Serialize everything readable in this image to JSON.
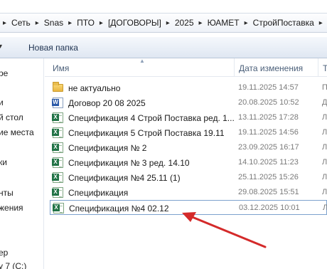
{
  "address_bar": {
    "crumbs": [
      "Сеть",
      "Snas",
      "ПТО",
      "[ДОГОВОРЫ]",
      "2025",
      "ЮАМЕТ",
      "СтройПоставка"
    ]
  },
  "toolbar": {
    "new_folder_label": "Новая папка"
  },
  "nav_pane": {
    "items": [
      "ре",
      "и",
      "й стол",
      "ие места",
      "ки",
      "нты",
      "жения",
      "ер",
      "у 7 (C:)"
    ]
  },
  "columns": {
    "name": "Имя",
    "date": "Дата изменения",
    "type_partial": "Т"
  },
  "files": [
    {
      "name": "не актуально",
      "date": "19.11.2025 14:57",
      "type": "П",
      "icon": "folder-icon"
    },
    {
      "name": "Договор 20 08 2025",
      "date": "20.08.2025 10:52",
      "type": "Д",
      "icon": "word-document-icon"
    },
    {
      "name": "Спецификация 4 Строй Поставка ред. 1...",
      "date": "13.11.2025 17:28",
      "type": "Л",
      "icon": "excel-spreadsheet-icon"
    },
    {
      "name": "Спецификация 5 Строй Поставка 19.11",
      "date": "19.11.2025 14:56",
      "type": "Л",
      "icon": "excel-spreadsheet-icon"
    },
    {
      "name": "Спецификация № 2",
      "date": "23.09.2025 16:17",
      "type": "Л",
      "icon": "excel-spreadsheet-icon"
    },
    {
      "name": "Спецификация № 3 ред. 14.10",
      "date": "14.10.2025 11:23",
      "type": "Л",
      "icon": "excel-spreadsheet-icon"
    },
    {
      "name": "Спецификация №4 25.11 (1)",
      "date": "25.11.2025 15:26",
      "type": "Л",
      "icon": "excel-spreadsheet-icon"
    },
    {
      "name": "Спецификация",
      "date": "29.08.2025 15:51",
      "type": "Л",
      "icon": "excel-spreadsheet-icon"
    },
    {
      "name": "Спецификация №4 02.12",
      "date": "03.12.2025 10:01",
      "type": "Л",
      "icon": "excel-spreadsheet-icon"
    }
  ],
  "annotation": {
    "color": "#d42a2a"
  }
}
